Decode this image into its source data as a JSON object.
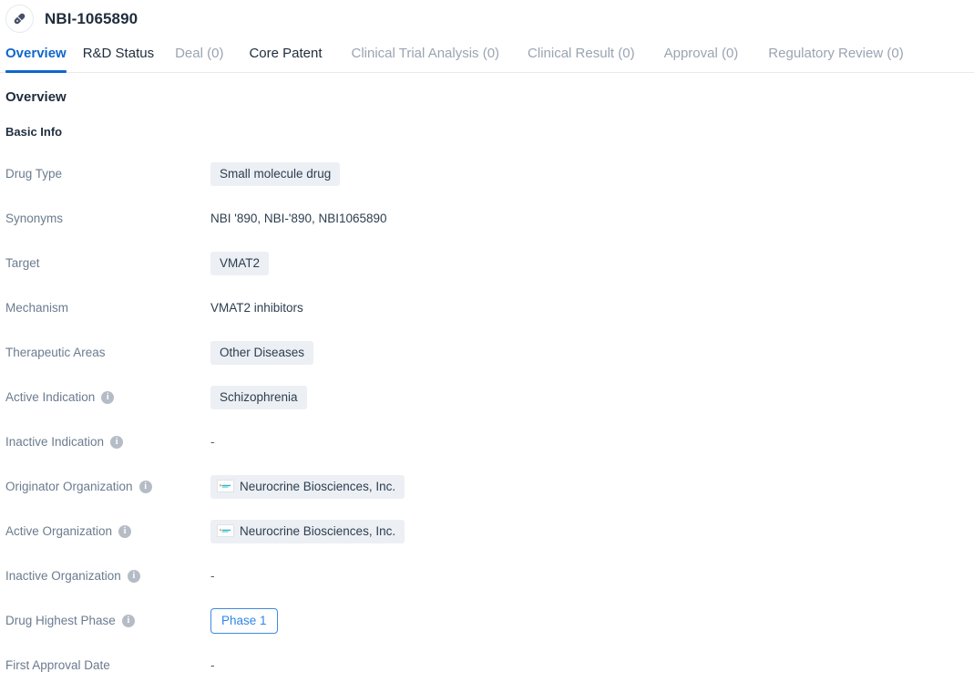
{
  "header": {
    "icon": "pill-capsule-icon",
    "title": "NBI-1065890"
  },
  "tabs": [
    {
      "label": "Overview",
      "state": "active"
    },
    {
      "label": "R&D Status",
      "state": "enabled"
    },
    {
      "label": "Deal (0)",
      "state": "disabled"
    },
    {
      "label": "Core Patent",
      "state": "enabled"
    },
    {
      "label": "Clinical Trial Analysis (0)",
      "state": "disabled"
    },
    {
      "label": "Clinical Result (0)",
      "state": "disabled"
    },
    {
      "label": "Approval (0)",
      "state": "disabled"
    },
    {
      "label": "Regulatory Review (0)",
      "state": "disabled"
    }
  ],
  "overview": {
    "section_title": "Overview",
    "subsection_title": "Basic Info",
    "rows": [
      {
        "label": "Drug Type",
        "info": false,
        "type": "chip",
        "value": "Small molecule drug"
      },
      {
        "label": "Synonyms",
        "info": false,
        "type": "text",
        "value": "NBI '890,  NBI-'890,  NBI1065890"
      },
      {
        "label": "Target",
        "info": false,
        "type": "chip",
        "value": "VMAT2"
      },
      {
        "label": "Mechanism",
        "info": false,
        "type": "text",
        "value": "VMAT2 inhibitors"
      },
      {
        "label": "Therapeutic Areas",
        "info": false,
        "type": "chip",
        "value": "Other Diseases"
      },
      {
        "label": "Active Indication",
        "info": true,
        "type": "chip",
        "value": "Schizophrenia"
      },
      {
        "label": "Inactive Indication",
        "info": true,
        "type": "dash",
        "value": "-"
      },
      {
        "label": "Originator Organization",
        "info": true,
        "type": "org",
        "value": "Neurocrine Biosciences, Inc."
      },
      {
        "label": "Active Organization",
        "info": true,
        "type": "org",
        "value": "Neurocrine Biosciences, Inc."
      },
      {
        "label": "Inactive Organization",
        "info": true,
        "type": "dash",
        "value": "-"
      },
      {
        "label": "Drug Highest Phase",
        "info": true,
        "type": "outline",
        "value": "Phase 1"
      },
      {
        "label": "First Approval Date",
        "info": false,
        "type": "dash",
        "value": "-"
      }
    ],
    "info_icon_glyph": "i"
  },
  "colors": {
    "accent": "#1068c9",
    "label": "#6b7b8f",
    "chip_bg": "#eceff3",
    "phase_border": "#3f8ae0",
    "phase_text": "#2f86e8",
    "disabled_tab": "#9aa4b2"
  }
}
